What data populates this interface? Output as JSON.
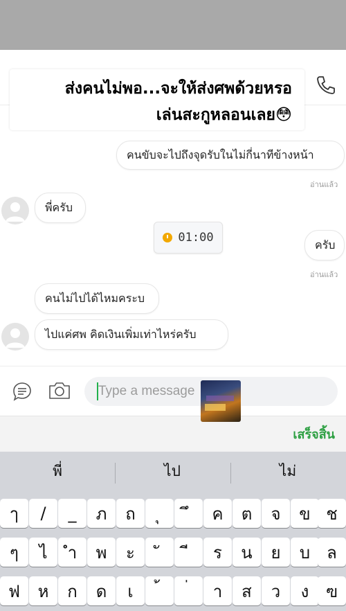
{
  "caption": {
    "line1": "ส่งคนไม่พอ...จะให้ส่งศพด้วยหรอ",
    "line2": "เล่นสะกูหลอนเลย😳"
  },
  "messages": {
    "m1": "คนขับจะไปถึงจุดรับในไม่กี่นาทีข้างหน้า",
    "m1_read": "อ่านแล้ว",
    "m2": "พี่ครับ",
    "timer": "01:00",
    "m3": "ครับ",
    "m3_read": "อ่านแล้ว",
    "m4": "คนไม่ไปได้ไหมคระบ",
    "m5": "ไปแค่ศพ คิดเงินเพิ่มเท่าไหร่ครับ"
  },
  "input": {
    "placeholder": "Type a message"
  },
  "done_label": "เสร็จสิ้น",
  "keyboard": {
    "suggestions": [
      "พี่",
      "ไป",
      "ไม่"
    ],
    "row1": [
      "ๅ",
      "/",
      "_",
      "ภ",
      "ถ",
      "ุ",
      "ึ",
      "ค",
      "ต",
      "จ",
      "ข",
      "ช"
    ],
    "row2": [
      "ๆ",
      "ไ",
      "ำ",
      "พ",
      "ะ",
      "ั",
      "ี",
      "ร",
      "น",
      "ย",
      "บ",
      "ล"
    ],
    "row3": [
      "ฟ",
      "ห",
      "ก",
      "ด",
      "เ",
      "้",
      "่",
      "า",
      "ส",
      "ว",
      "ง",
      "ฃ"
    ]
  },
  "icons": [
    "phone-icon",
    "chat-bubble-icon",
    "camera-icon",
    "clock-icon",
    "avatar-icon"
  ],
  "colors": {
    "accent_green": "#2ea043",
    "timer_icon": "#f2a800",
    "top_gray": "#a9a9a9",
    "keyboard_bg": "#d3d5da"
  }
}
